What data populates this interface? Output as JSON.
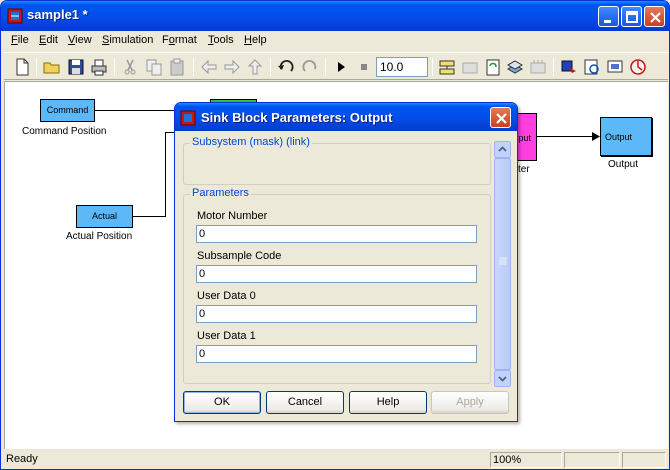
{
  "window": {
    "title": "sample1 *"
  },
  "menu": [
    "File",
    "Edit",
    "View",
    "Simulation",
    "Format",
    "Tools",
    "Help"
  ],
  "menu_mnemonics": [
    "F",
    "E",
    "V",
    "S",
    "o",
    "T",
    "H"
  ],
  "toolbar": {
    "stop_time": "10.0"
  },
  "blocks": {
    "command": {
      "text": "Command",
      "label": "Command Position"
    },
    "actual": {
      "text": "Actual",
      "label": "Actual Position"
    },
    "output": {
      "text": "Output",
      "label": "Output"
    },
    "hidden_block_partial_text": "tput",
    "hidden_block_partial_label": "ter"
  },
  "status": {
    "left": "Ready",
    "zoom": "100%"
  },
  "dialog": {
    "title": "Sink Block Parameters: Output",
    "subsystem_legend": "Subsystem (mask) (link)",
    "parameters_legend": "Parameters",
    "fields": [
      {
        "label": "Motor Number",
        "value": "0"
      },
      {
        "label": "Subsample Code",
        "value": "0"
      },
      {
        "label": "User Data 0",
        "value": "0"
      },
      {
        "label": "User Data 1",
        "value": "0"
      }
    ],
    "buttons": {
      "ok": "OK",
      "cancel": "Cancel",
      "help": "Help",
      "apply": "Apply"
    }
  },
  "colors": {
    "block_fill": "#5cb8f7",
    "pink_block": "#ff3fe0",
    "green_block": "#26c93a",
    "title_blue": "#0053ee"
  }
}
